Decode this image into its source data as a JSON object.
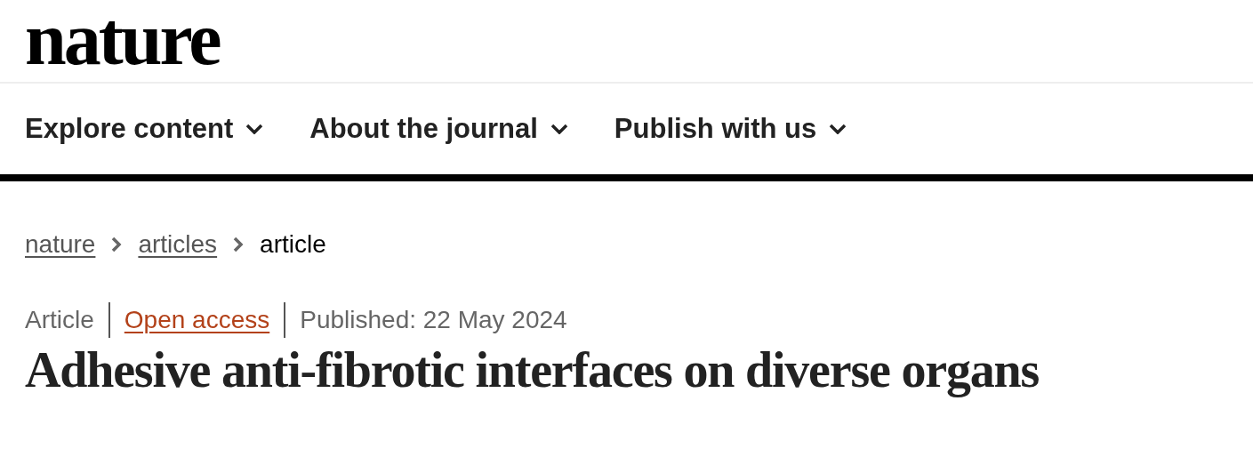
{
  "logo": "nature",
  "nav": [
    {
      "label": "Explore content"
    },
    {
      "label": "About the journal"
    },
    {
      "label": "Publish with us"
    }
  ],
  "breadcrumbs": [
    {
      "label": "nature",
      "kind": "link"
    },
    {
      "label": "articles",
      "kind": "link"
    },
    {
      "label": "article",
      "kind": "current"
    }
  ],
  "meta": [
    {
      "text": "Article",
      "kind": "type"
    },
    {
      "text": "Open access",
      "kind": "access"
    },
    {
      "text": "Published: 22 May 2024",
      "kind": "date"
    }
  ],
  "title": "Adhesive anti-fibrotic interfaces on diverse organs"
}
